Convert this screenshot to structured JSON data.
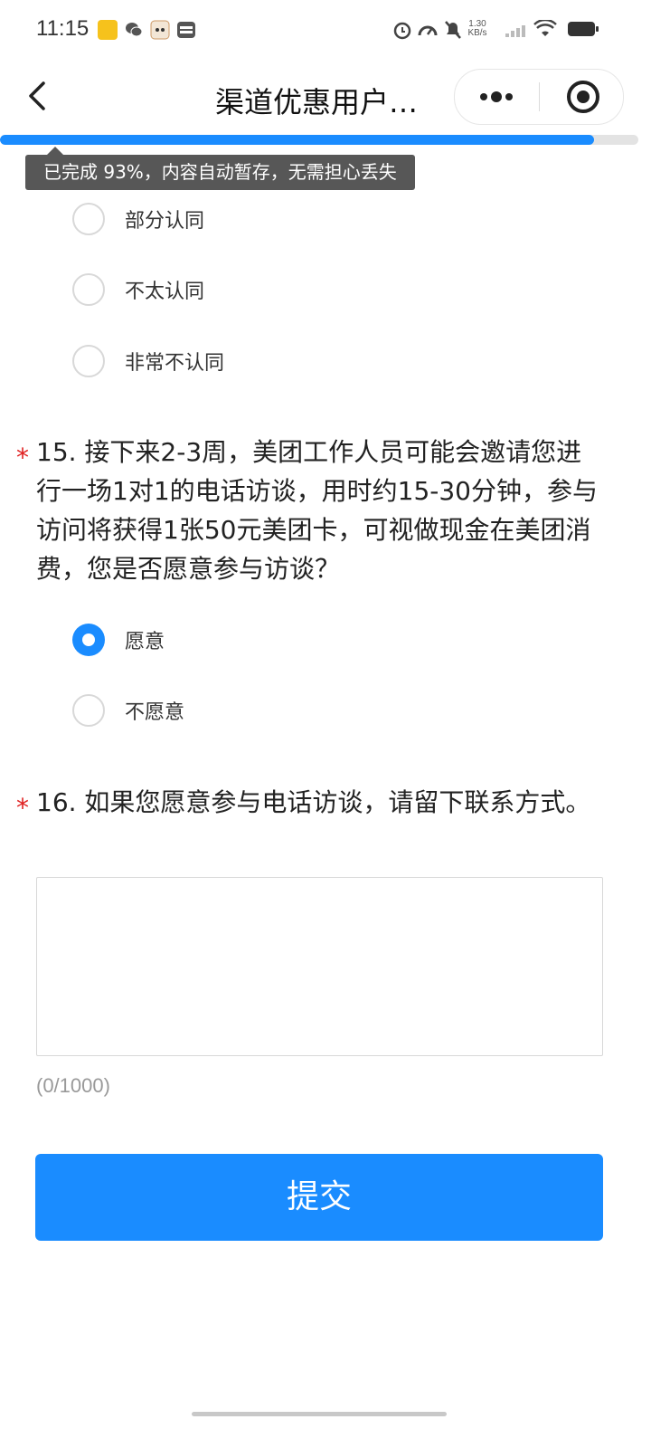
{
  "status_bar": {
    "time": "11:15",
    "net_speed_value": "1.30",
    "net_speed_unit": "KB/s",
    "icons": [
      "meituan-app-icon",
      "wechat-icon",
      "cat-app-icon",
      "wallet-app-icon",
      "alarm-icon",
      "speedometer-icon",
      "mute-bell-icon",
      "signal-icon",
      "wifi-icon",
      "battery-icon"
    ]
  },
  "nav": {
    "title": "渠道优惠用户…",
    "icons": [
      "back-chevron-icon",
      "more-dots-icon",
      "target-close-icon"
    ]
  },
  "progress": {
    "percent": 93,
    "tooltip": "已完成 93%，内容自动暂存，无需担心丢失",
    "fill_color": "#1a8cff"
  },
  "prev_question_options": [
    {
      "label": "部分认同",
      "checked": false
    },
    {
      "label": "不太认同",
      "checked": false
    },
    {
      "label": "非常不认同",
      "checked": false
    }
  ],
  "q15": {
    "required_mark": "*",
    "text": "15. 接下来2-3周，美团工作人员可能会邀请您进行一场1对1的电话访谈，用时约15-30分钟，参与访问将获得1张50元美团卡，可视做现金在美团消费，您是否愿意参与访谈？",
    "options": [
      {
        "label": "愿意",
        "checked": true
      },
      {
        "label": "不愿意",
        "checked": false
      }
    ]
  },
  "q16": {
    "required_mark": "*",
    "text": "16. 如果您愿意参与电话访谈，请留下联系方式。",
    "value": "",
    "char_count": "(0/1000)"
  },
  "submit_label": "提交",
  "colors": {
    "accent": "#1a8cff",
    "required": "#e02020"
  }
}
